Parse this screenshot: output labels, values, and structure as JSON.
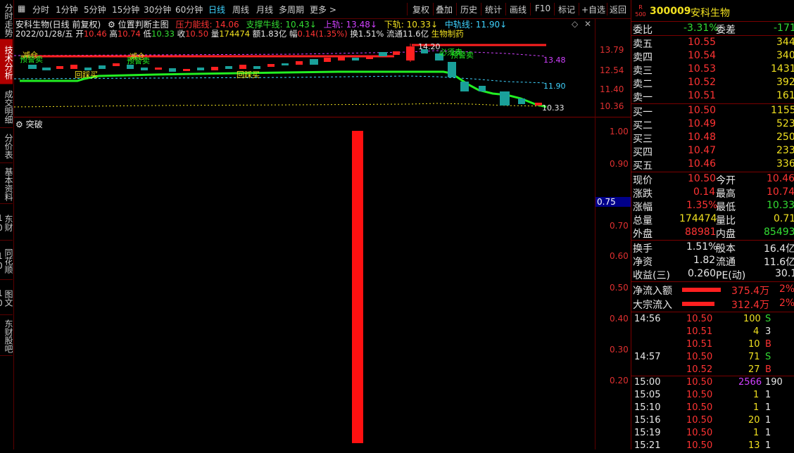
{
  "left_tabs": [
    {
      "label": "分时走势"
    },
    {
      "label": "技术分析"
    },
    {
      "label": "成交明细"
    },
    {
      "label": "分价表"
    },
    {
      "label": "基本资料"
    },
    {
      "label": "东财10"
    },
    {
      "label": "同花顺10"
    },
    {
      "label": "图文10"
    },
    {
      "label": "东财股吧"
    }
  ],
  "toolbar": {
    "periods": [
      "分时",
      "1分钟",
      "5分钟",
      "15分钟",
      "30分钟",
      "60分钟",
      "日线",
      "周线",
      "月线",
      "多周期",
      "更多 >"
    ],
    "active_period": "日线",
    "tools": [
      "复权",
      "叠加",
      "历史",
      "统计",
      "画线",
      "F10",
      "标记",
      "+自选",
      "返回"
    ]
  },
  "info": {
    "stock_title": "安科生物(日线 前复权)",
    "indicator_name": "位置判断主图",
    "pressure_label": "压力能线:",
    "pressure_value": "14.06",
    "support_label": "支撑牛线:",
    "support_value": "10.43↓",
    "upper_label": "上轨:",
    "upper_value": "13.48↓",
    "lower_label": "下轨:",
    "lower_value": "10.33↓",
    "mid_label": "中轨线:",
    "mid_value": "11.90↓",
    "date": "2022/01/28/五",
    "open_label": "开",
    "open": "10.46",
    "high_label": "高",
    "high": "10.74",
    "low_label": "低",
    "low": "10.33",
    "close_label": "收",
    "close": "10.50",
    "vol_label": "量",
    "vol": "174474",
    "amount_label": "额",
    "amount": "1.83亿",
    "amp_label": "幅",
    "amp": "0.14(1.35%)",
    "turn_label": "换",
    "turn": "1.51%",
    "float_label": "流通",
    "float": "11.6亿",
    "sector": "生物制药"
  },
  "main_chart": {
    "y_ticks": [
      "13.79",
      "12.54",
      "11.40",
      "10.36"
    ],
    "label_upper": "13.48",
    "label_mid": "11.90",
    "label_low": "10.33",
    "peak_label": "14.20",
    "signals": [
      "减仓",
      "预警卖",
      "回踩买",
      "减仓",
      "预警卖",
      "回踩买",
      "必须卖",
      "预警卖"
    ]
  },
  "sub_chart": {
    "title": "突破",
    "y_ticks": [
      "1.00",
      "0.90",
      "0.75",
      "0.70",
      "0.60",
      "0.50",
      "0.40",
      "0.30",
      "0.20"
    ],
    "current_marker": "0.75"
  },
  "quote": {
    "code": "300009",
    "name": "安科生物",
    "badge_top": "R",
    "badge_bottom": "500",
    "wei_bi_label": "委比",
    "wei_bi": "-3.31%",
    "wei_cha_label": "委差",
    "wei_cha": "-171",
    "asks": [
      {
        "label": "卖五",
        "price": "10.55",
        "vol": "344"
      },
      {
        "label": "卖四",
        "price": "10.54",
        "vol": "340"
      },
      {
        "label": "卖三",
        "price": "10.53",
        "vol": "1431"
      },
      {
        "label": "卖二",
        "price": "10.52",
        "vol": "392"
      },
      {
        "label": "卖一",
        "price": "10.51",
        "vol": "161"
      }
    ],
    "bids": [
      {
        "label": "买一",
        "price": "10.50",
        "vol": "1155"
      },
      {
        "label": "买二",
        "price": "10.49",
        "vol": "523"
      },
      {
        "label": "买三",
        "price": "10.48",
        "vol": "250"
      },
      {
        "label": "买四",
        "price": "10.47",
        "vol": "233"
      },
      {
        "label": "买五",
        "price": "10.46",
        "vol": "336"
      }
    ],
    "stats": [
      {
        "l1": "现价",
        "v1": "10.50",
        "l2": "今开",
        "v2": "10.46"
      },
      {
        "l1": "涨跌",
        "v1": "0.14",
        "l2": "最高",
        "v2": "10.74"
      },
      {
        "l1": "涨幅",
        "v1": "1.35%",
        "l2": "最低",
        "v2": "10.33"
      },
      {
        "l1": "总量",
        "v1": "174474",
        "l2": "量比",
        "v2": "0.71"
      },
      {
        "l1": "外盘",
        "v1": "88981",
        "l2": "内盘",
        "v2": "85493"
      }
    ],
    "stats2": [
      {
        "l1": "换手",
        "v1": "1.51%",
        "l2": "股本",
        "v2": "16.4亿"
      },
      {
        "l1": "净资",
        "v1": "1.82",
        "l2": "流通",
        "v2": "11.6亿"
      },
      {
        "l1": "收益(三)",
        "v1": "0.260",
        "l2": "PE(动)",
        "v2": "30.1"
      }
    ],
    "flows": [
      {
        "label": "净流入额",
        "value": "375.4万",
        "pct": "2%",
        "bar": 0.95
      },
      {
        "label": "大宗流入",
        "value": "312.4万",
        "pct": "2%",
        "bar": 0.8
      }
    ],
    "trades": [
      {
        "time": "14:56",
        "price": "10.50",
        "vol": "100",
        "side": "S"
      },
      {
        "time": "",
        "price": "10.51",
        "vol": "4",
        "side": "3"
      },
      {
        "time": "",
        "price": "10.51",
        "vol": "10",
        "side": "B"
      },
      {
        "time": "14:57",
        "price": "10.50",
        "vol": "71",
        "side": "S"
      },
      {
        "time": "",
        "price": "10.52",
        "vol": "27",
        "side": "B"
      },
      {
        "time": "15:00",
        "price": "10.50",
        "vol": "2566",
        "side": "190"
      },
      {
        "time": "15:05",
        "price": "10.50",
        "vol": "1",
        "side": "1"
      },
      {
        "time": "15:10",
        "price": "10.50",
        "vol": "1",
        "side": "1"
      },
      {
        "time": "15:16",
        "price": "10.50",
        "vol": "20",
        "side": "1"
      },
      {
        "time": "15:19",
        "price": "10.50",
        "vol": "1",
        "side": "1"
      },
      {
        "time": "15:21",
        "price": "10.50",
        "vol": "13",
        "side": "1"
      }
    ],
    "trade_sides_extra": [
      "5",
      "",
      "2",
      "9",
      "2"
    ]
  },
  "colors": {
    "up": "#ff3333",
    "down": "#33dd33",
    "accent": "#3fd3ff",
    "border": "#7a0000"
  }
}
